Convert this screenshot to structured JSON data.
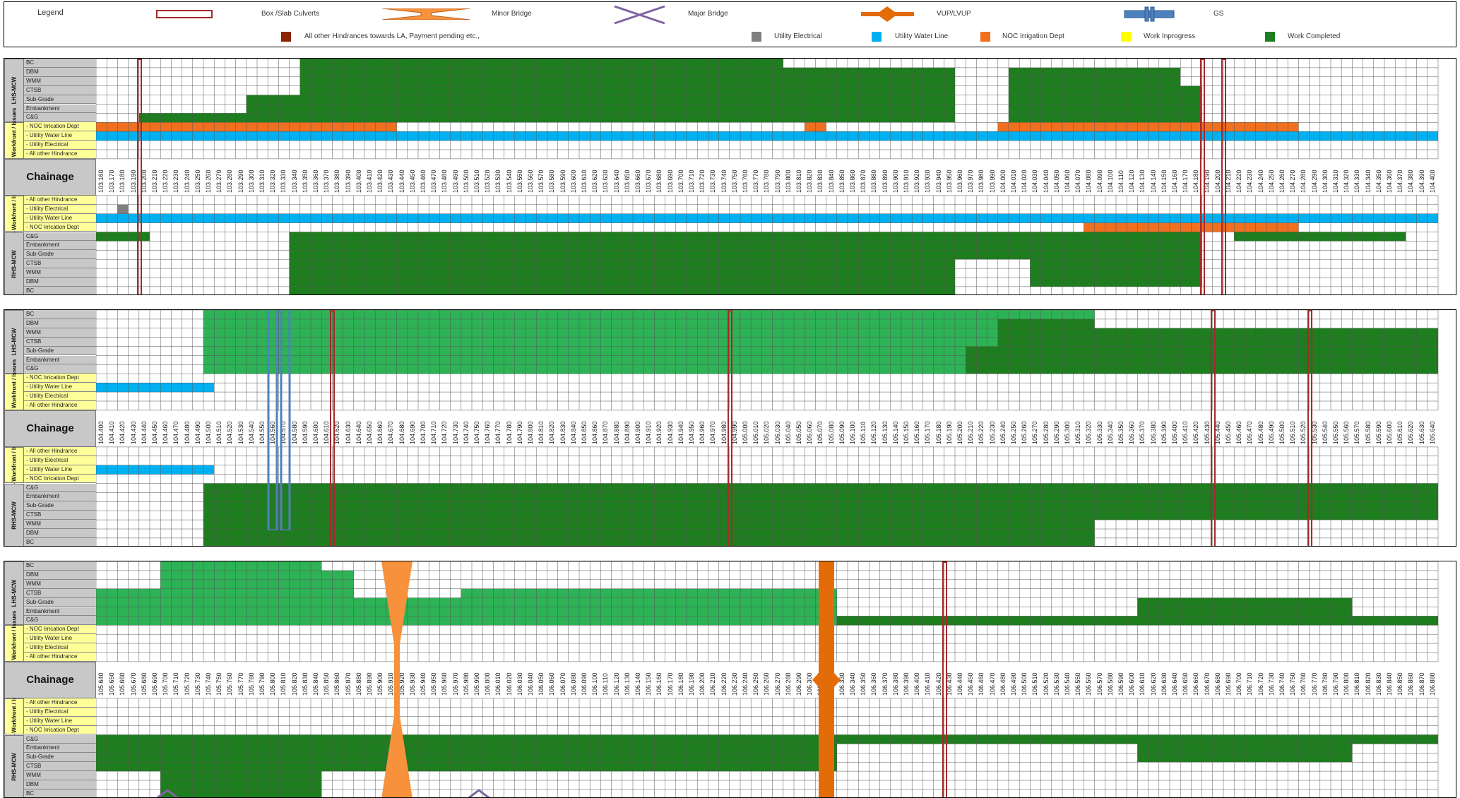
{
  "legend": {
    "title": "Legend",
    "items": [
      {
        "label": "Box /Slab Culverts",
        "icon": "box-culvert-symbol"
      },
      {
        "label": "Minor Bridge",
        "icon": "minor-bridge-symbol"
      },
      {
        "label": "Major Bridge",
        "icon": "major-bridge-symbol"
      },
      {
        "label": "VUP/LVUP",
        "icon": "vup-symbol"
      },
      {
        "label": "GS",
        "icon": "gs-symbol"
      }
    ],
    "hindrances": [
      {
        "label": "All other Hindrances towards LA, Payment pending etc.,",
        "color": "#8b2500"
      },
      {
        "label": "Utility Electrical",
        "color": "#808080"
      },
      {
        "label": "Utility Water Line",
        "color": "#00b0f0"
      },
      {
        "label": "NOC Irrigation Dept",
        "color": "#f07020"
      },
      {
        "label": "Work Inprogress",
        "color": "#ffff00"
      },
      {
        "label": "Work Completed",
        "color": "#1e7d1e"
      }
    ]
  },
  "colors": {
    "done": "#1e7d1e",
    "done_light": "#2db256",
    "water": "#00b0f0",
    "noc": "#f07020",
    "elec": "#808080",
    "label_grey": "#c8c8c8",
    "label_yellow": "#ffff99",
    "culvert": "#a52a2a",
    "bridge": "#f7913b",
    "vup": "#e36c09",
    "major": "#8064a2",
    "gs": "#4f81bd"
  },
  "row_labels": {
    "lhs_mcw": [
      "BC",
      "DBM",
      "WMM",
      "CTSB",
      "Sub-Grade",
      "Embankment",
      "C&G"
    ],
    "lhs_hind_1": [
      "- NOC Irrication Dept",
      "- Utility Water Line",
      "- Utility Electrical",
      "- All other Hindrance"
    ],
    "rhs_hind_1": [
      "- All other Hindrance",
      "- Utility Electrical",
      "- Utility Water Line",
      "- NOC Irrication Dept"
    ],
    "lhs_hind_2": [
      "- NOC Irrication Dept",
      "- Utility Water Line",
      "- Utility Electrical",
      "- All other Hindrance"
    ],
    "rhs_hind_2": [
      "- All other Hindrance",
      "- Utility Electrical",
      "- Utility Water Line",
      "- NOC Irrication Dept"
    ],
    "lhs_hind_3": [
      "- NOC Irrication Dept",
      "- Utility Water Line",
      "- Utility Electrical",
      "- All other Hindrance"
    ],
    "rhs_hind_3": [
      "- All other Hindrance",
      "- Utility Electrical",
      "- Utility Water Line",
      "- NOC Irrication Dept"
    ],
    "rhs_mcw": [
      "C&G",
      "Embankment",
      "Sub-Grade",
      "CTSB",
      "WMM",
      "DBM",
      "BC"
    ]
  },
  "group_labels": {
    "lhs_mcw": "LHS-MCW",
    "lhs_workfront": "LHS - Workfront / Issues",
    "chainage": "Chainage",
    "rhs_workfront": "RHS - Workfront / Issues",
    "rhs_mcw": "RHS-MCW"
  },
  "panels": [
    {
      "start": 103.16,
      "count": 125,
      "lhs": [
        {
          "row": 0,
          "ranges": [
            [
              19,
              64
            ]
          ]
        },
        {
          "row": 1,
          "ranges": [
            [
              19,
              80
            ],
            [
              85,
              101
            ]
          ]
        },
        {
          "row": 2,
          "ranges": [
            [
              19,
              80
            ],
            [
              85,
              101
            ]
          ]
        },
        {
          "row": 3,
          "ranges": [
            [
              19,
              80
            ],
            [
              85,
              103
            ]
          ]
        },
        {
          "row": 4,
          "ranges": [
            [
              14,
              80
            ],
            [
              85,
              103
            ]
          ]
        },
        {
          "row": 5,
          "ranges": [
            [
              14,
              80
            ],
            [
              85,
              103
            ]
          ]
        },
        {
          "row": 6,
          "ranges": [
            [
              4,
              80
            ],
            [
              85,
              103
            ]
          ]
        }
      ],
      "lhs_light": [],
      "lhs_hind": [
        {
          "row": 0,
          "type": "noc",
          "ranges": [
            [
              0,
              28
            ],
            [
              66,
              68
            ],
            [
              84,
              112
            ]
          ]
        },
        {
          "row": 1,
          "type": "water",
          "ranges": [
            [
              0,
              125
            ]
          ]
        }
      ],
      "rhs_hind": [
        {
          "row": 1,
          "type": "elec",
          "ranges": [
            [
              2,
              3
            ]
          ]
        },
        {
          "row": 2,
          "type": "water",
          "ranges": [
            [
              0,
              125
            ]
          ]
        },
        {
          "row": 3,
          "type": "noc",
          "ranges": [
            [
              92,
              112
            ]
          ]
        }
      ],
      "rhs": [
        {
          "row": 0,
          "ranges": [
            [
              0,
              5
            ],
            [
              18,
              103
            ],
            [
              106,
              122
            ]
          ]
        },
        {
          "row": 1,
          "ranges": [
            [
              18,
              103
            ]
          ]
        },
        {
          "row": 2,
          "ranges": [
            [
              18,
              103
            ]
          ]
        },
        {
          "row": 3,
          "ranges": [
            [
              18,
              80
            ],
            [
              87,
              103
            ]
          ]
        },
        {
          "row": 4,
          "ranges": [
            [
              18,
              80
            ],
            [
              87,
              103
            ]
          ]
        },
        {
          "row": 5,
          "ranges": [
            [
              18,
              80
            ],
            [
              87,
              103
            ]
          ]
        },
        {
          "row": 6,
          "ranges": [
            [
              18,
              80
            ]
          ]
        }
      ],
      "rhs_light": [],
      "culverts": [
        103.2,
        104.19,
        104.21
      ],
      "struct": []
    },
    {
      "start": 104.4,
      "count": 125,
      "lhs": [
        {
          "row": 1,
          "ranges": [
            [
              84,
              93
            ]
          ]
        },
        {
          "row": 2,
          "ranges": [
            [
              84,
              125
            ]
          ]
        },
        {
          "row": 3,
          "ranges": [
            [
              84,
              125
            ]
          ]
        },
        {
          "row": 4,
          "ranges": [
            [
              81,
              125
            ]
          ]
        },
        {
          "row": 5,
          "ranges": [
            [
              81,
              125
            ]
          ]
        },
        {
          "row": 6,
          "ranges": [
            [
              81,
              125
            ]
          ]
        }
      ],
      "lhs_light": [
        {
          "row": 0,
          "ranges": [
            [
              10,
              93
            ]
          ]
        },
        {
          "row": 1,
          "ranges": [
            [
              10,
              84
            ]
          ]
        },
        {
          "row": 2,
          "ranges": [
            [
              10,
              84
            ]
          ]
        },
        {
          "row": 3,
          "ranges": [
            [
              10,
              84
            ]
          ]
        },
        {
          "row": 4,
          "ranges": [
            [
              10,
              81
            ]
          ]
        },
        {
          "row": 5,
          "ranges": [
            [
              10,
              81
            ]
          ]
        },
        {
          "row": 6,
          "ranges": [
            [
              10,
              81
            ]
          ]
        }
      ],
      "lhs_hind": [
        {
          "row": 1,
          "type": "water",
          "ranges": [
            [
              0,
              11
            ]
          ]
        }
      ],
      "rhs_hind": [
        {
          "row": 2,
          "type": "water",
          "ranges": [
            [
              0,
              11
            ]
          ]
        }
      ],
      "rhs": [
        {
          "row": 0,
          "ranges": [
            [
              10,
              125
            ]
          ]
        },
        {
          "row": 1,
          "ranges": [
            [
              10,
              125
            ]
          ]
        },
        {
          "row": 2,
          "ranges": [
            [
              10,
              125
            ]
          ]
        },
        {
          "row": 3,
          "ranges": [
            [
              10,
              125
            ]
          ]
        },
        {
          "row": 4,
          "ranges": [
            [
              10,
              93
            ]
          ]
        },
        {
          "row": 5,
          "ranges": [
            [
              10,
              93
            ]
          ]
        },
        {
          "row": 6,
          "ranges": [
            [
              10,
              93
            ]
          ]
        }
      ],
      "rhs_light": [],
      "culverts": [
        104.62,
        104.99,
        105.44,
        105.53
      ],
      "struct": [
        {
          "type": "gs",
          "at": 104.57
        }
      ]
    },
    {
      "start": 105.64,
      "count": 125,
      "lhs": [
        {
          "row": 6,
          "ranges": [
            [
              69,
              125
            ]
          ]
        },
        {
          "row": 5,
          "ranges": [
            [
              97,
              117
            ]
          ]
        },
        {
          "row": 4,
          "ranges": [
            [
              97,
              117
            ]
          ]
        }
      ],
      "lhs_light": [
        {
          "row": 0,
          "ranges": [
            [
              6,
              21
            ]
          ]
        },
        {
          "row": 1,
          "ranges": [
            [
              6,
              24
            ]
          ]
        },
        {
          "row": 2,
          "ranges": [
            [
              6,
              24
            ]
          ]
        },
        {
          "row": 3,
          "ranges": [
            [
              0,
              24
            ],
            [
              34,
              69
            ]
          ]
        },
        {
          "row": 4,
          "ranges": [
            [
              0,
              69
            ]
          ]
        },
        {
          "row": 5,
          "ranges": [
            [
              0,
              69
            ]
          ]
        },
        {
          "row": 6,
          "ranges": [
            [
              0,
              69
            ]
          ]
        }
      ],
      "lhs_hind": [],
      "rhs_hind": [],
      "rhs": [
        {
          "row": 0,
          "ranges": [
            [
              0,
              125
            ]
          ]
        },
        {
          "row": 1,
          "ranges": [
            [
              0,
              69
            ],
            [
              97,
              117
            ]
          ]
        },
        {
          "row": 2,
          "ranges": [
            [
              0,
              69
            ],
            [
              97,
              117
            ]
          ]
        },
        {
          "row": 3,
          "ranges": [
            [
              0,
              69
            ]
          ]
        },
        {
          "row": 4,
          "ranges": [
            [
              6,
              21
            ]
          ]
        },
        {
          "row": 5,
          "ranges": [
            [
              6,
              21
            ]
          ]
        },
        {
          "row": 6,
          "ranges": [
            [
              6,
              21
            ]
          ]
        }
      ],
      "rhs_light": [],
      "culverts": [
        106.43
      ],
      "struct": [
        {
          "type": "bridge",
          "at": 105.92
        },
        {
          "type": "vup",
          "at": 106.32
        }
      ]
    }
  ]
}
